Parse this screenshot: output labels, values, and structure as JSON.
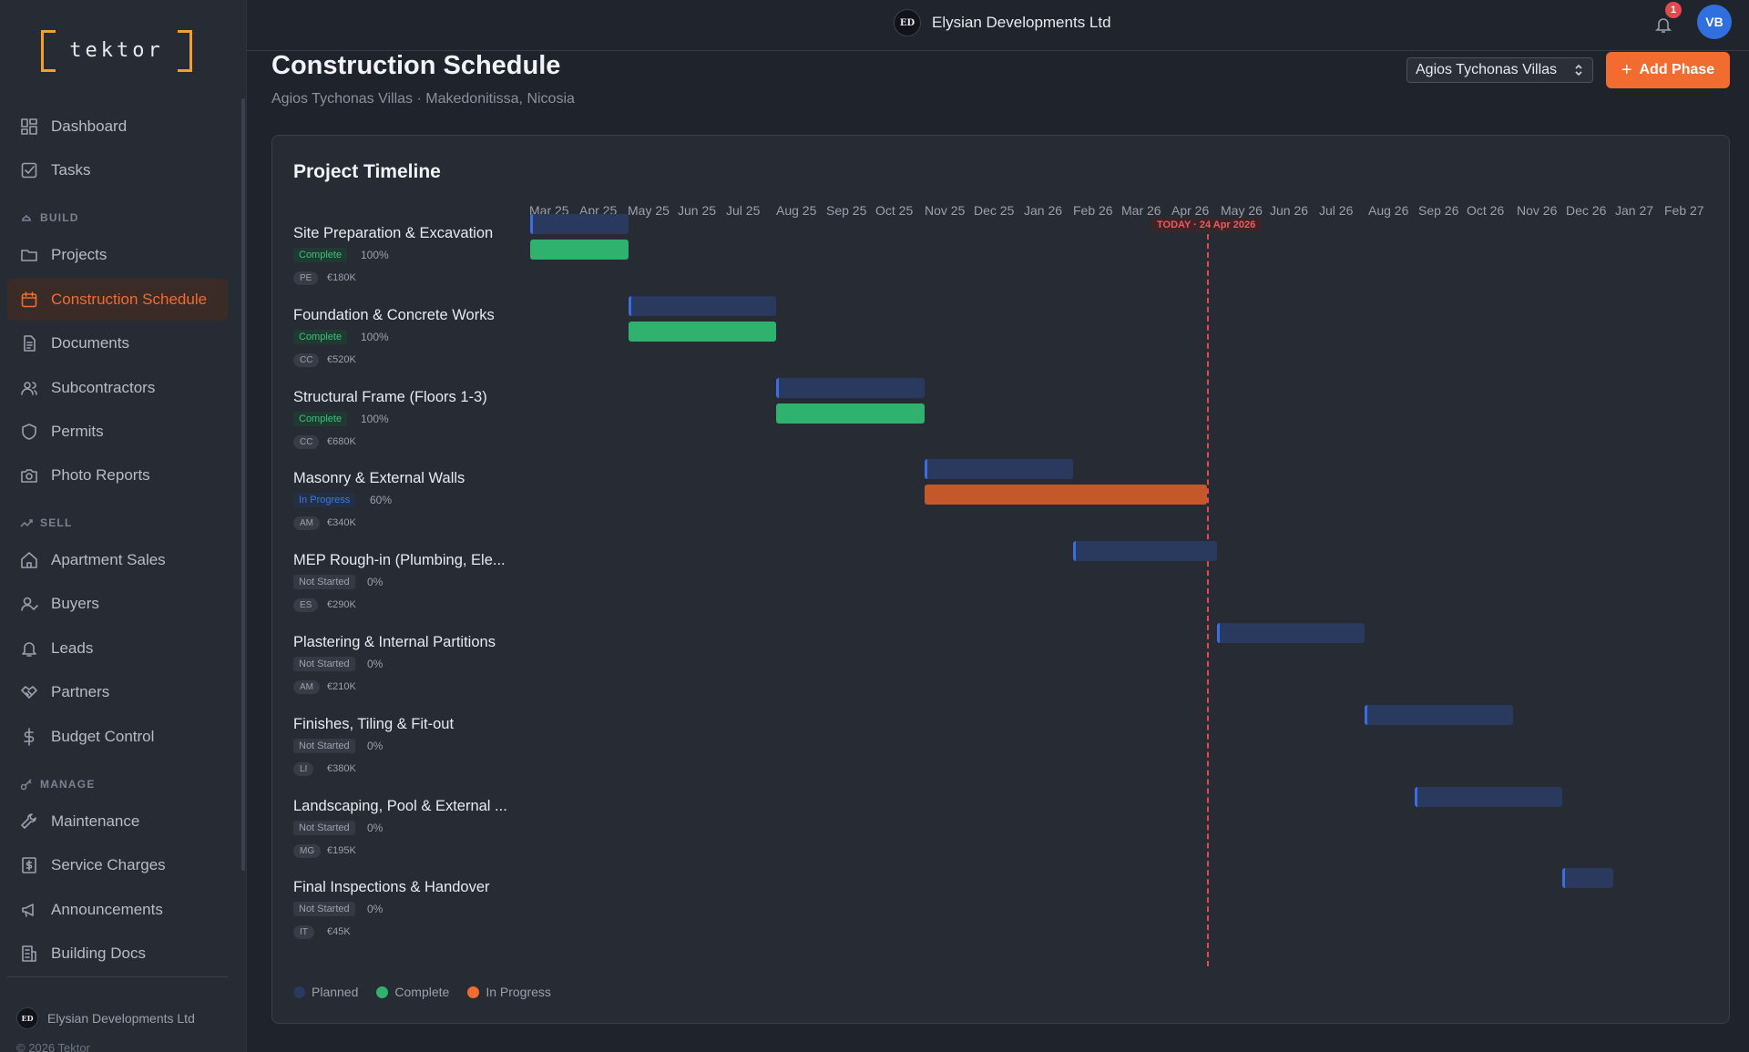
{
  "app": {
    "logo_text": "tektor"
  },
  "nav": {
    "dashboard": "Dashboard",
    "tasks": "Tasks",
    "section_build": "BUILD",
    "projects": "Projects",
    "schedule": "Construction Schedule",
    "documents": "Documents",
    "subcontractors": "Subcontractors",
    "permits": "Permits",
    "photo_reports": "Photo Reports",
    "section_sell": "SELL",
    "apartment_sales": "Apartment Sales",
    "buyers": "Buyers",
    "leads": "Leads",
    "partners": "Partners",
    "budget_control": "Budget Control",
    "section_manage": "MANAGE",
    "maintenance": "Maintenance",
    "service_charges": "Service Charges",
    "announcements": "Announcements",
    "building_docs": "Building Docs"
  },
  "footer": {
    "org_badge": "ED",
    "org_name": "Elysian Developments Ltd",
    "copyright": "© 2026 Tektor"
  },
  "topbar": {
    "org_badge": "ED",
    "org_name": "Elysian Developments Ltd",
    "notif_count": "1",
    "user_initials": "VB"
  },
  "header": {
    "title": "Construction Schedule",
    "subtitle": "Agios Tychonas Villas · Makedonitissa, Nicosia",
    "project_select": "Agios Tychonas Villas",
    "add_label": "Add Phase"
  },
  "timeline": {
    "title": "Project Timeline",
    "months": [
      "Mar 25",
      "Apr 25",
      "May 25",
      "Jun 25",
      "Jul 25",
      "Aug 25",
      "Sep 25",
      "Oct 25",
      "Nov 25",
      "Dec 25",
      "Jan 26",
      "Feb 26",
      "Mar 26",
      "Apr 26",
      "May 26",
      "Jun 26",
      "Jul 26",
      "Aug 26",
      "Sep 26",
      "Oct 26",
      "Nov 26",
      "Dec 26",
      "Jan 27",
      "Feb 27"
    ],
    "today_label": "TODAY · 24 Apr 2026",
    "phases": [
      {
        "name": "Site Preparation & Excavation",
        "status": "Complete",
        "percent": "100%",
        "lead": "PE",
        "budget": "€180K"
      },
      {
        "name": "Foundation & Concrete Works",
        "status": "Complete",
        "percent": "100%",
        "lead": "CC",
        "budget": "€520K"
      },
      {
        "name": "Structural Frame (Floors 1-3)",
        "status": "Complete",
        "percent": "100%",
        "lead": "CC",
        "budget": "€680K"
      },
      {
        "name": "Masonry & External Walls",
        "status": "In Progress",
        "percent": "60%",
        "lead": "AM",
        "budget": "€340K"
      },
      {
        "name": "MEP Rough-in (Plumbing, Ele...",
        "status": "Not Started",
        "percent": "0%",
        "lead": "ES",
        "budget": "€290K"
      },
      {
        "name": "Plastering & Internal Partitions",
        "status": "Not Started",
        "percent": "0%",
        "lead": "AM",
        "budget": "€210K"
      },
      {
        "name": "Finishes, Tiling & Fit-out",
        "status": "Not Started",
        "percent": "0%",
        "lead": "LI",
        "budget": "€380K"
      },
      {
        "name": "Landscaping, Pool & External ...",
        "status": "Not Started",
        "percent": "0%",
        "lead": "MG",
        "budget": "€195K"
      },
      {
        "name": "Final Inspections & Handover",
        "status": "Not Started",
        "percent": "0%",
        "lead": "IT",
        "budget": "€45K"
      }
    ],
    "legend": {
      "planned": "Planned",
      "complete": "Complete",
      "progress": "In Progress"
    }
  },
  "colors": {
    "accent": "#f26b2f",
    "planned": "#2a3a5e",
    "complete": "#2fb26e",
    "in_progress": "#c4582a",
    "today": "#e5484d"
  }
}
